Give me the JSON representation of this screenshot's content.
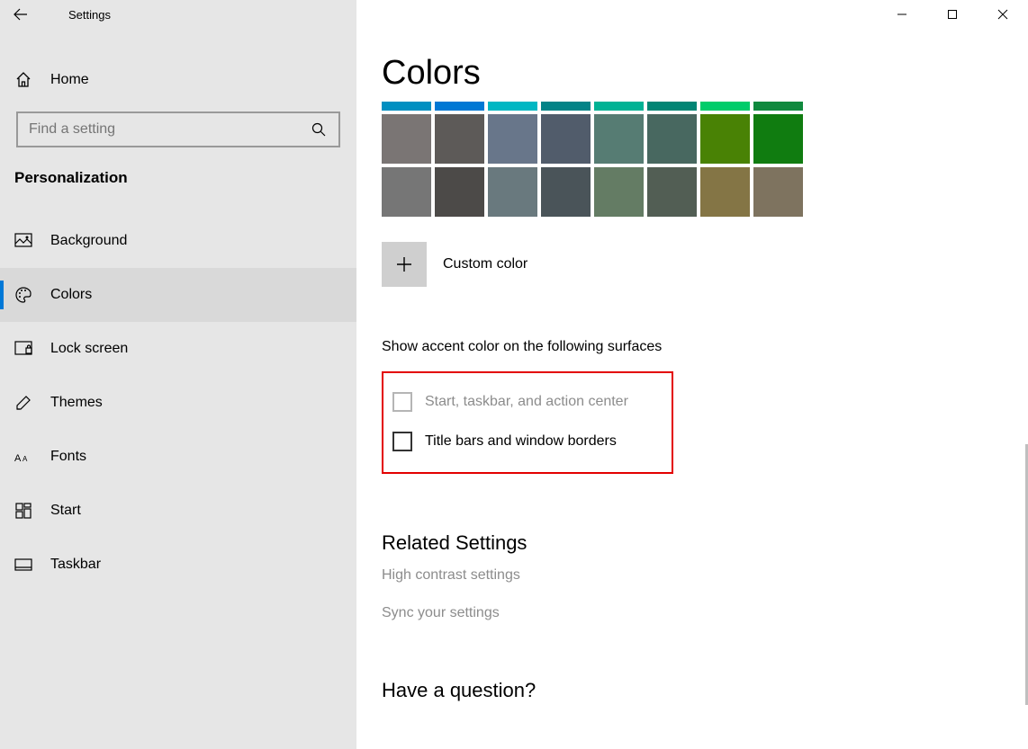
{
  "window": {
    "title": "Settings"
  },
  "sidebar": {
    "home": "Home",
    "search_placeholder": "Find a setting",
    "section": "Personalization",
    "items": [
      {
        "label": "Background"
      },
      {
        "label": "Colors"
      },
      {
        "label": "Lock screen"
      },
      {
        "label": "Themes"
      },
      {
        "label": "Fonts"
      },
      {
        "label": "Start"
      },
      {
        "label": "Taskbar"
      }
    ]
  },
  "main": {
    "title": "Colors",
    "swatch_rows": [
      [
        "#008fc1",
        "#0078d4",
        "#00b7c3",
        "#038387",
        "#00b294",
        "#018574",
        "#00cc6a",
        "#10893e"
      ],
      [
        "#7a7574",
        "#5d5a58",
        "#68768a",
        "#515c6b",
        "#567c73",
        "#486860",
        "#498205",
        "#107c10"
      ],
      [
        "#767676",
        "#4c4a48",
        "#69797e",
        "#4a5459",
        "#647c64",
        "#525e54",
        "#847545",
        "#7e735f"
      ]
    ],
    "custom_label": "Custom color",
    "surfaces_heading": "Show accent color on the following surfaces",
    "checks": [
      {
        "label": "Start, taskbar, and action center",
        "disabled": true
      },
      {
        "label": "Title bars and window borders",
        "disabled": false
      }
    ],
    "related_heading": "Related Settings",
    "related_links": [
      "High contrast settings",
      "Sync your settings"
    ],
    "help_heading": "Have a question?"
  }
}
